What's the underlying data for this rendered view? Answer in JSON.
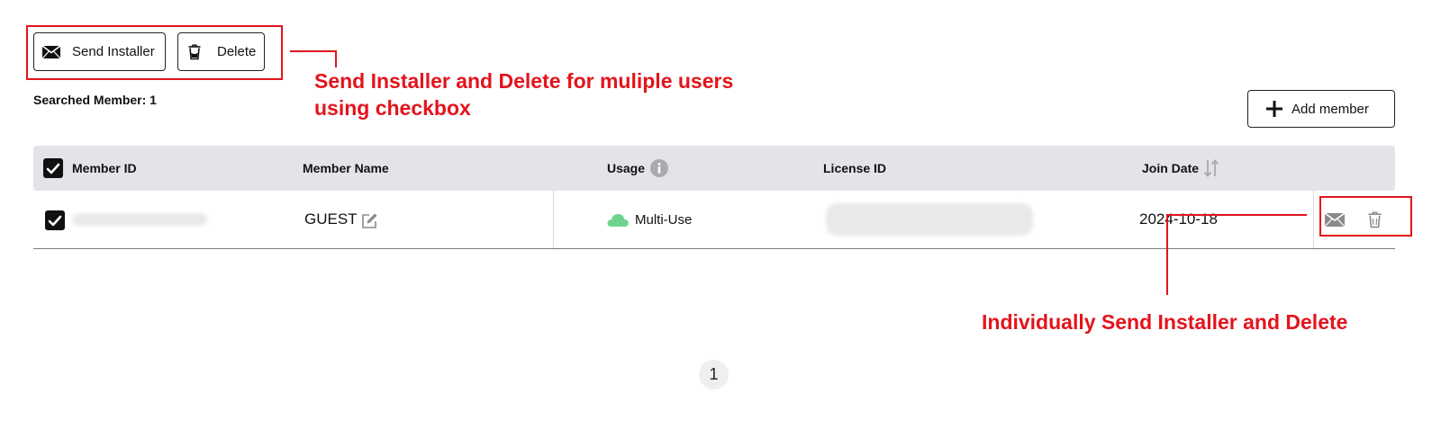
{
  "toolbar": {
    "send_installer_label": "Send Installer",
    "delete_label": "Delete",
    "add_member_label": "Add member"
  },
  "search": {
    "searched_members": "Searched Member: 1"
  },
  "table": {
    "columns": [
      "Member ID",
      "Member Name",
      "Usage",
      "License ID",
      "Join Date"
    ],
    "header_checked": true,
    "rows": [
      {
        "checked": true,
        "member_id": "",
        "member_name": "GUEST",
        "usage": "Multi-Use",
        "license_id": "",
        "join_date": "2024-10-18"
      }
    ]
  },
  "annotations": {
    "bulk_actions": "Send Installer and Delete for muliple users using checkbox",
    "row_actions": "Individually Send Installer and Delete"
  },
  "pagination": {
    "current_page": "1"
  },
  "colors": {
    "annotation": "#e3141c",
    "header_bg": "#e2e4e8",
    "usage_cloud": "#6fd38f",
    "icon_gray": "#8a8a8a"
  },
  "icons": {
    "send": "envelope-icon",
    "delete": "trash-icon",
    "add": "plus-icon",
    "edit": "edit-icon",
    "info": "info-icon",
    "sort": "sort-icon",
    "usage": "cloud-icon"
  }
}
